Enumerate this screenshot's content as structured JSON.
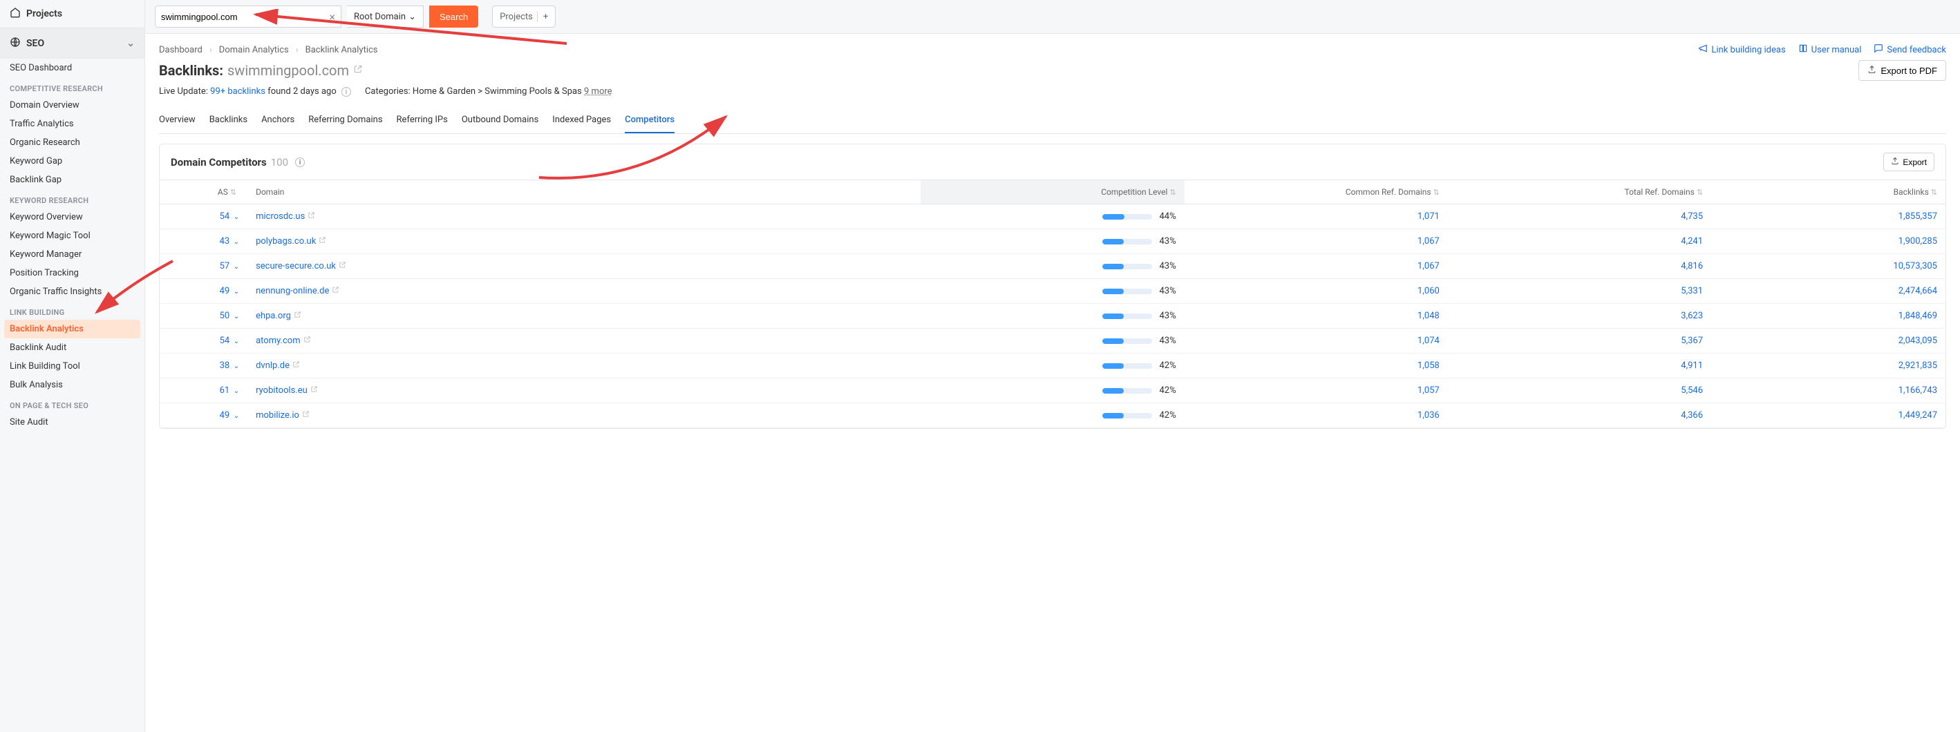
{
  "sidebar": {
    "top_label": "Projects",
    "seo_label": "SEO",
    "items_flat": [
      "SEO Dashboard"
    ],
    "heading_competitive": "COMPETITIVE RESEARCH",
    "items_competitive": [
      "Domain Overview",
      "Traffic Analytics",
      "Organic Research",
      "Keyword Gap",
      "Backlink Gap"
    ],
    "heading_keyword": "KEYWORD RESEARCH",
    "items_keyword": [
      "Keyword Overview",
      "Keyword Magic Tool",
      "Keyword Manager",
      "Position Tracking",
      "Organic Traffic Insights"
    ],
    "heading_link": "LINK BUILDING",
    "items_link": [
      "Backlink Analytics",
      "Backlink Audit",
      "Link Building Tool",
      "Bulk Analysis"
    ],
    "active_link_item": "Backlink Analytics",
    "heading_onpage": "ON PAGE & TECH SEO",
    "items_onpage": [
      "Site Audit"
    ]
  },
  "topbar": {
    "search_value": "swimmingpool.com",
    "root_domain_label": "Root Domain",
    "search_button": "Search",
    "projects_label": "Projects"
  },
  "breadcrumb": [
    "Dashboard",
    "Domain Analytics",
    "Backlink Analytics"
  ],
  "header_links": {
    "link_ideas": "Link building ideas",
    "user_manual": "User manual",
    "send_feedback": "Send feedback"
  },
  "page_title_prefix": "Backlinks:",
  "page_title_domain": "swimmingpool.com",
  "export_pdf_label": "Export to PDF",
  "meta": {
    "live_update_label": "Live Update:",
    "backlinks_link": "99+ backlinks",
    "found_text": "found 2 days ago",
    "categories_label": "Categories:",
    "categories_value": "Home & Garden > Swimming Pools & Spas",
    "more_label": "9 more"
  },
  "tabs": [
    "Overview",
    "Backlinks",
    "Anchors",
    "Referring Domains",
    "Referring IPs",
    "Outbound Domains",
    "Indexed Pages",
    "Competitors"
  ],
  "active_tab": "Competitors",
  "panel": {
    "title": "Domain Competitors",
    "count": "100",
    "export_label": "Export"
  },
  "columns": {
    "as": "AS",
    "domain": "Domain",
    "competition": "Competition Level",
    "common": "Common Ref. Domains",
    "total": "Total Ref. Domains",
    "backlinks": "Backlinks"
  },
  "rows": [
    {
      "as": "54",
      "domain": "microsdc.us",
      "comp": "44%",
      "comp_w": 44,
      "common": "1,071",
      "total": "4,735",
      "backlinks": "1,855,357"
    },
    {
      "as": "43",
      "domain": "polybags.co.uk",
      "comp": "43%",
      "comp_w": 43,
      "common": "1,067",
      "total": "4,241",
      "backlinks": "1,900,285"
    },
    {
      "as": "57",
      "domain": "secure-secure.co.uk",
      "comp": "43%",
      "comp_w": 43,
      "common": "1,067",
      "total": "4,816",
      "backlinks": "10,573,305"
    },
    {
      "as": "49",
      "domain": "nennung-online.de",
      "comp": "43%",
      "comp_w": 43,
      "common": "1,060",
      "total": "5,331",
      "backlinks": "2,474,664"
    },
    {
      "as": "50",
      "domain": "ehpa.org",
      "comp": "43%",
      "comp_w": 43,
      "common": "1,048",
      "total": "3,623",
      "backlinks": "1,848,469"
    },
    {
      "as": "54",
      "domain": "atomy.com",
      "comp": "43%",
      "comp_w": 43,
      "common": "1,074",
      "total": "5,367",
      "backlinks": "2,043,095"
    },
    {
      "as": "38",
      "domain": "dvnlp.de",
      "comp": "42%",
      "comp_w": 42,
      "common": "1,058",
      "total": "4,911",
      "backlinks": "2,921,835"
    },
    {
      "as": "61",
      "domain": "ryobitools.eu",
      "comp": "42%",
      "comp_w": 42,
      "common": "1,057",
      "total": "5,546",
      "backlinks": "1,166,743"
    },
    {
      "as": "49",
      "domain": "mobilize.io",
      "comp": "42%",
      "comp_w": 42,
      "common": "1,036",
      "total": "4,366",
      "backlinks": "1,449,247"
    }
  ]
}
